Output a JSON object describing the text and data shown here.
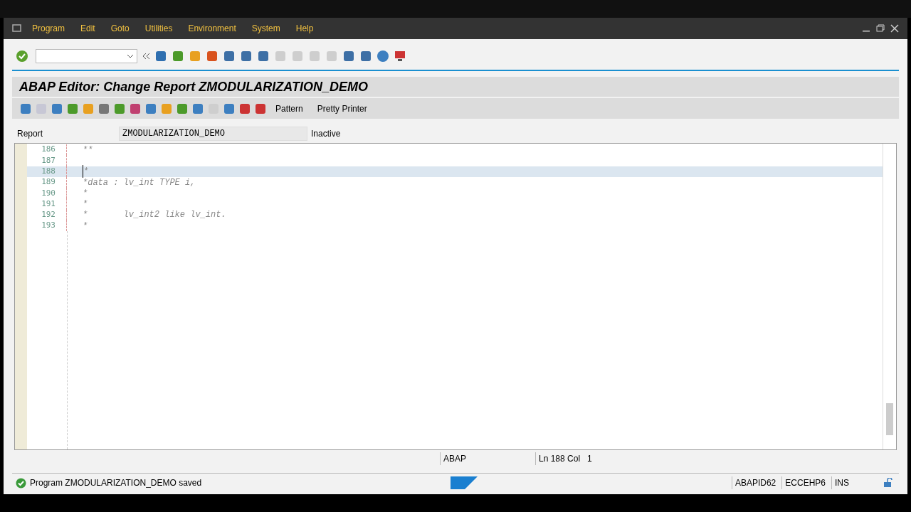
{
  "menu": [
    "Program",
    "Edit",
    "Goto",
    "Utilities",
    "Environment",
    "System",
    "Help"
  ],
  "title": "ABAP Editor: Change Report ZMODULARIZATION_DEMO",
  "app_toolbar": {
    "buttons": [
      "Pattern",
      "Pretty Printer"
    ]
  },
  "report": {
    "label": "Report",
    "value": "ZMODULARIZATION_DEMO",
    "status": "Inactive"
  },
  "editor": {
    "lines": [
      {
        "number": "186",
        "text": "**",
        "selected": false
      },
      {
        "number": "187",
        "selected": false
      },
      {
        "number": "188",
        "text": "*",
        "selected": true
      },
      {
        "number": "189",
        "text": "*data : lv_int TYPE i,",
        "selected": false
      },
      {
        "number": "190",
        "text": "*",
        "selected": false
      },
      {
        "number": "191",
        "text": "*",
        "selected": false
      },
      {
        "number": "192",
        "text": "*       lv_int2 like lv_int.",
        "selected": false
      },
      {
        "number": "193",
        "text": "*",
        "selected": false
      }
    ],
    "status": {
      "language": "ABAP",
      "position": "Ln 188 Col   1"
    }
  },
  "status_bar": {
    "message": "Program ZMODULARIZATION_DEMO saved",
    "system": "ABAPID62",
    "client": "ECCEHP6",
    "mode": "INS"
  }
}
